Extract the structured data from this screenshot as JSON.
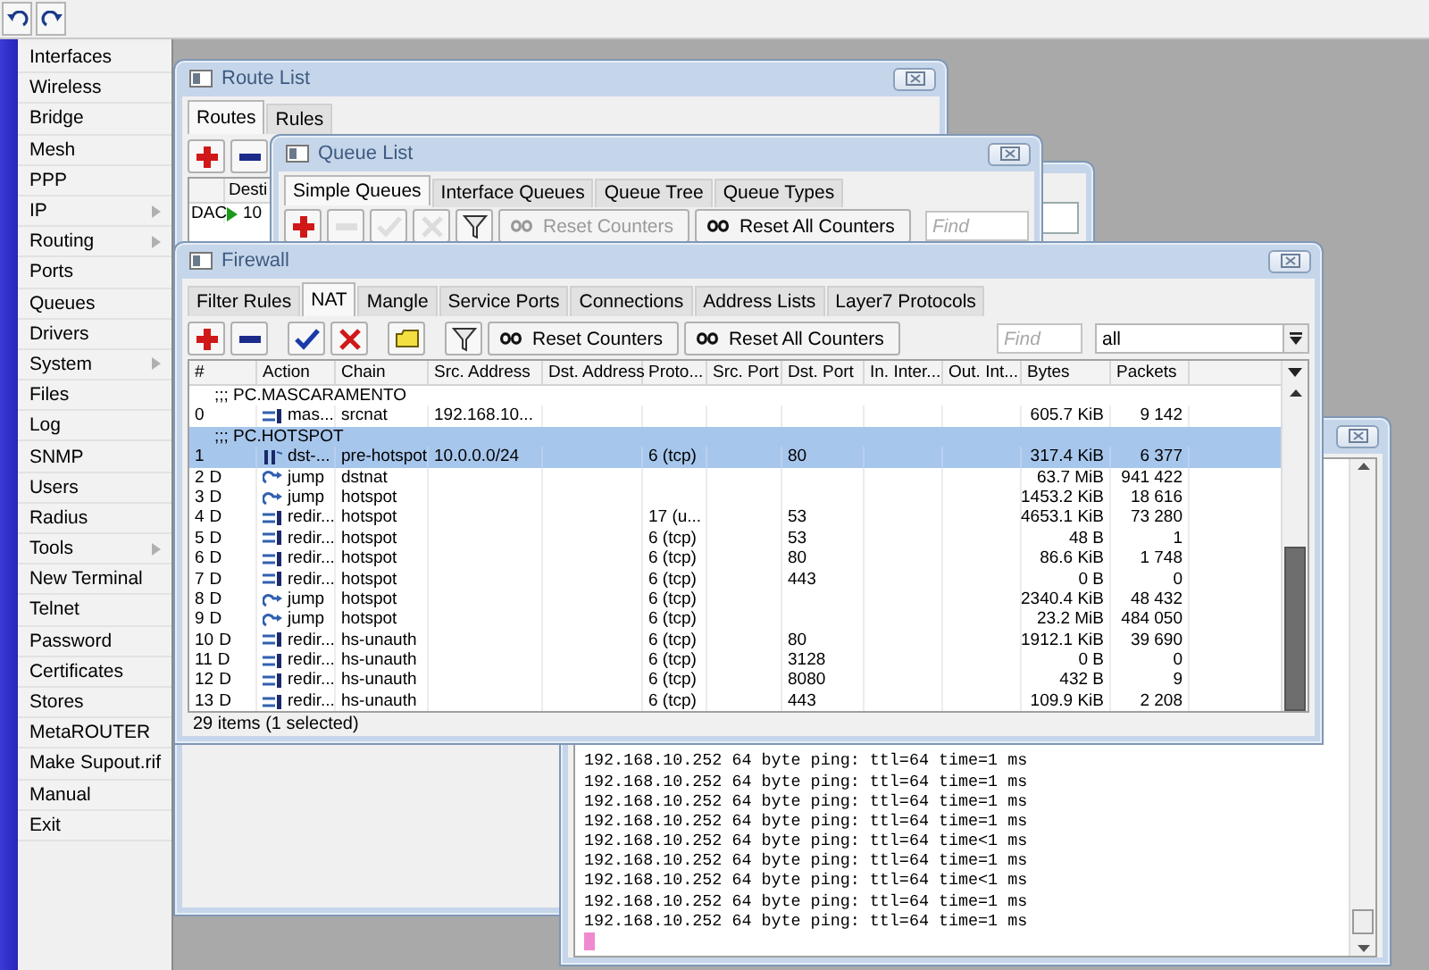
{
  "menu": {
    "items": [
      {
        "label": "Interfaces",
        "submenu": false
      },
      {
        "label": "Wireless",
        "submenu": false
      },
      {
        "label": "Bridge",
        "submenu": false
      },
      {
        "label": "Mesh",
        "submenu": false
      },
      {
        "label": "PPP",
        "submenu": false
      },
      {
        "label": "IP",
        "submenu": true
      },
      {
        "label": "Routing",
        "submenu": true
      },
      {
        "label": "Ports",
        "submenu": false
      },
      {
        "label": "Queues",
        "submenu": false
      },
      {
        "label": "Drivers",
        "submenu": false
      },
      {
        "label": "System",
        "submenu": true
      },
      {
        "label": "Files",
        "submenu": false
      },
      {
        "label": "Log",
        "submenu": false
      },
      {
        "label": "SNMP",
        "submenu": false
      },
      {
        "label": "Users",
        "submenu": false
      },
      {
        "label": "Radius",
        "submenu": false
      },
      {
        "label": "Tools",
        "submenu": true
      },
      {
        "label": "New Terminal",
        "submenu": false
      },
      {
        "label": "Telnet",
        "submenu": false
      },
      {
        "label": "Password",
        "submenu": false
      },
      {
        "label": "Certificates",
        "submenu": false
      },
      {
        "label": "Stores",
        "submenu": false
      },
      {
        "label": "MetaROUTER",
        "submenu": false
      },
      {
        "label": "Make Supout.rif",
        "submenu": false
      },
      {
        "label": "Manual",
        "submenu": false
      },
      {
        "label": "Exit",
        "submenu": false
      }
    ]
  },
  "route_list": {
    "title": "Route List",
    "tabs": [
      {
        "label": "Routes",
        "selected": true
      },
      {
        "label": "Rules",
        "selected": false
      }
    ],
    "toolbar": [
      {
        "kind": "add",
        "disabled": false
      },
      {
        "kind": "remove",
        "disabled": false
      }
    ],
    "columns": [
      "Desti"
    ],
    "rows": [
      {
        "type": "DAC",
        "destination": "10"
      }
    ]
  },
  "queue_list": {
    "title": "Queue List",
    "tabs": [
      {
        "label": "Simple Queues",
        "selected": true
      },
      {
        "label": "Interface Queues",
        "selected": false
      },
      {
        "label": "Queue Tree",
        "selected": false
      },
      {
        "label": "Queue Types",
        "selected": false
      }
    ],
    "toolbar": [
      {
        "kind": "add",
        "disabled": false
      },
      {
        "kind": "remove",
        "disabled": true
      },
      {
        "kind": "enable",
        "disabled": true
      },
      {
        "kind": "disable",
        "disabled": true
      },
      {
        "kind": "filter",
        "disabled": false
      }
    ],
    "counter_buttons": [
      {
        "label": "Reset Counters",
        "disabled": true
      },
      {
        "label": "Reset All Counters",
        "disabled": false
      }
    ],
    "search": {
      "placeholder": "Find"
    }
  },
  "firewall": {
    "title": "Firewall",
    "tabs": [
      {
        "label": "Filter Rules",
        "selected": false
      },
      {
        "label": "NAT",
        "selected": true
      },
      {
        "label": "Mangle",
        "selected": false
      },
      {
        "label": "Service Ports",
        "selected": false
      },
      {
        "label": "Connections",
        "selected": false
      },
      {
        "label": "Address Lists",
        "selected": false
      },
      {
        "label": "Layer7 Protocols",
        "selected": false
      }
    ],
    "toolbar": [
      {
        "kind": "add",
        "disabled": false
      },
      {
        "kind": "remove",
        "disabled": false
      },
      {
        "kind": "enable",
        "disabled": false
      },
      {
        "kind": "disable",
        "disabled": false
      },
      {
        "kind": "comment",
        "disabled": false
      },
      {
        "kind": "filter",
        "disabled": false
      }
    ],
    "counter_buttons": [
      {
        "label": "Reset Counters",
        "disabled": false
      },
      {
        "label": "Reset All Counters",
        "disabled": false
      }
    ],
    "search": {
      "placeholder": "Find"
    },
    "filter": {
      "value": "all"
    },
    "columns": [
      "#",
      "Action",
      "Chain",
      "Src. Address",
      "Dst. Address",
      "Proto...",
      "Src. Port",
      "Dst. Port",
      "In. Inter...",
      "Out. Int...",
      "Bytes",
      "Packets"
    ],
    "rows": [
      {
        "kind": "comment",
        "text": ";;; PC.MASCARAMENTO",
        "selected": false
      },
      {
        "kind": "nat",
        "number": "0",
        "action": "mas...",
        "chain": "srcnat",
        "src_address": "192.168.10...",
        "bytes": "605.7 KiB",
        "packets": "9 142",
        "selected": false
      },
      {
        "kind": "comment",
        "text": ";;; PC.HOTSPOT",
        "selected": true
      },
      {
        "kind": "dstnat",
        "number": "1",
        "action": "dst-...",
        "chain": "pre-hotspot",
        "src_address": "10.0.0.0/24",
        "protocol": "6 (tcp)",
        "dst_port": "80",
        "bytes": "317.4 KiB",
        "packets": "6 377",
        "selected": true
      },
      {
        "kind": "jump",
        "number": "2",
        "flag": "D",
        "action": "jump",
        "chain": "dstnat",
        "bytes": "63.7 MiB",
        "packets": "941 422",
        "selected": false
      },
      {
        "kind": "jump",
        "number": "3",
        "flag": "D",
        "action": "jump",
        "chain": "hotspot",
        "bytes": "1453.2 KiB",
        "packets": "18 616",
        "selected": false
      },
      {
        "kind": "nat",
        "number": "4",
        "flag": "D",
        "action": "redir...",
        "chain": "hotspot",
        "protocol": "17 (u...",
        "dst_port": "53",
        "bytes": "4653.1 KiB",
        "packets": "73 280",
        "selected": false
      },
      {
        "kind": "nat",
        "number": "5",
        "flag": "D",
        "action": "redir...",
        "chain": "hotspot",
        "protocol": "6 (tcp)",
        "dst_port": "53",
        "bytes": "48 B",
        "packets": "1",
        "selected": false
      },
      {
        "kind": "nat",
        "number": "6",
        "flag": "D",
        "action": "redir...",
        "chain": "hotspot",
        "protocol": "6 (tcp)",
        "dst_port": "80",
        "bytes": "86.6 KiB",
        "packets": "1 748",
        "selected": false
      },
      {
        "kind": "nat",
        "number": "7",
        "flag": "D",
        "action": "redir...",
        "chain": "hotspot",
        "protocol": "6 (tcp)",
        "dst_port": "443",
        "bytes": "0 B",
        "packets": "0",
        "selected": false
      },
      {
        "kind": "jump",
        "number": "8",
        "flag": "D",
        "action": "jump",
        "chain": "hotspot",
        "protocol": "6 (tcp)",
        "bytes": "2340.4 KiB",
        "packets": "48 432",
        "selected": false
      },
      {
        "kind": "jump",
        "number": "9",
        "flag": "D",
        "action": "jump",
        "chain": "hotspot",
        "protocol": "6 (tcp)",
        "bytes": "23.2 MiB",
        "packets": "484 050",
        "selected": false
      },
      {
        "kind": "nat",
        "number": "10",
        "flag": "D",
        "action": "redir...",
        "chain": "hs-unauth",
        "protocol": "6 (tcp)",
        "dst_port": "80",
        "bytes": "1912.1 KiB",
        "packets": "39 690",
        "selected": false
      },
      {
        "kind": "nat",
        "number": "11",
        "flag": "D",
        "action": "redir...",
        "chain": "hs-unauth",
        "protocol": "6 (tcp)",
        "dst_port": "3128",
        "bytes": "0 B",
        "packets": "0",
        "selected": false
      },
      {
        "kind": "nat",
        "number": "12",
        "flag": "D",
        "action": "redir...",
        "chain": "hs-unauth",
        "protocol": "6 (tcp)",
        "dst_port": "8080",
        "bytes": "432 B",
        "packets": "9",
        "selected": false
      },
      {
        "kind": "nat",
        "number": "13",
        "flag": "D",
        "action": "redir...",
        "chain": "hs-unauth",
        "protocol": "6 (tcp)",
        "dst_port": "443",
        "bytes": "109.9 KiB",
        "packets": "2 208",
        "selected": false
      }
    ],
    "status": "29 items (1 selected)"
  },
  "terminal": {
    "lines": [
      "192.168.10.252 64 byte ping: ttl=64 time=1 ms",
      "192.168.10.252 64 byte ping: ttl=64 time=1 ms",
      "192.168.10.252 64 byte ping: ttl=64 time=1 ms",
      "192.168.10.252 64 byte ping: ttl=64 time=1 ms",
      "192.168.10.252 64 byte ping: ttl=64 time<1 ms",
      "192.168.10.252 64 byte ping: ttl=64 time=1 ms",
      "192.168.10.252 64 byte ping: ttl=64 time<1 ms",
      "192.168.10.252 64 byte ping: ttl=64 time=1 ms",
      "192.168.10.252 64 byte ping: ttl=64 time=1 ms"
    ]
  }
}
